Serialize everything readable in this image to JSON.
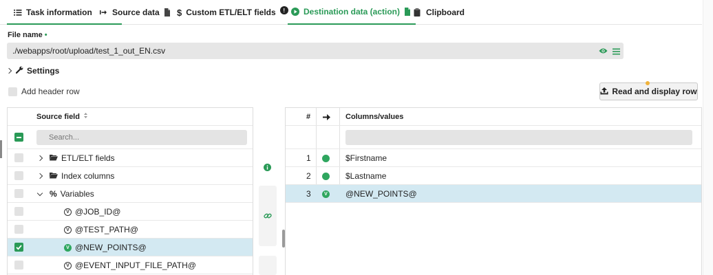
{
  "tabs": [
    {
      "label": "Task information",
      "icon": "list-icon"
    },
    {
      "label": "Source data",
      "icon": "import-arrow-icon"
    },
    {
      "label": "Custom ETL/ELT fields",
      "icon": "dollar-icon"
    },
    {
      "label": "Destination data (action)",
      "icon": "play-circle-icon",
      "active": true
    },
    {
      "label": "Clipboard",
      "icon": "clipboard-icon"
    }
  ],
  "file": {
    "label": "File name",
    "required_mark": "•",
    "value": "./webapps/root/upload/test_1_out_EN.csv"
  },
  "settings": {
    "label": "Settings"
  },
  "add_header": {
    "label": "Add header row",
    "checked": false
  },
  "read_button": {
    "label": "Read and display row"
  },
  "source": {
    "header": "Source field",
    "search_placeholder": "Search...",
    "rows": [
      {
        "label": "ETL/ELT fields",
        "kind": "folder",
        "expanded": false,
        "checked": false
      },
      {
        "label": "Index columns",
        "kind": "folder",
        "expanded": false,
        "checked": false
      },
      {
        "label": "Variables",
        "kind": "percent",
        "expanded": true,
        "checked": false
      },
      {
        "label": "@JOB_ID@",
        "kind": "variable",
        "checked": false
      },
      {
        "label": "@TEST_PATH@",
        "kind": "variable",
        "checked": false
      },
      {
        "label": "@NEW_POINTS@",
        "kind": "variable-selected",
        "checked": true
      },
      {
        "label": "@EVENT_INPUT_FILE_PATH@",
        "kind": "variable",
        "checked": false
      }
    ]
  },
  "destination": {
    "col_number": "#",
    "col_values": "Columns/values",
    "rows": [
      {
        "num": "1",
        "value": "$Firstname"
      },
      {
        "num": "2",
        "value": "$Lastname"
      },
      {
        "num": "3",
        "value": "@NEW_POINTS@",
        "selected": true
      }
    ]
  },
  "colors": {
    "accent": "#2a9a57",
    "selected_row": "#d3e9f2",
    "dot_green": "#2fa65f"
  }
}
